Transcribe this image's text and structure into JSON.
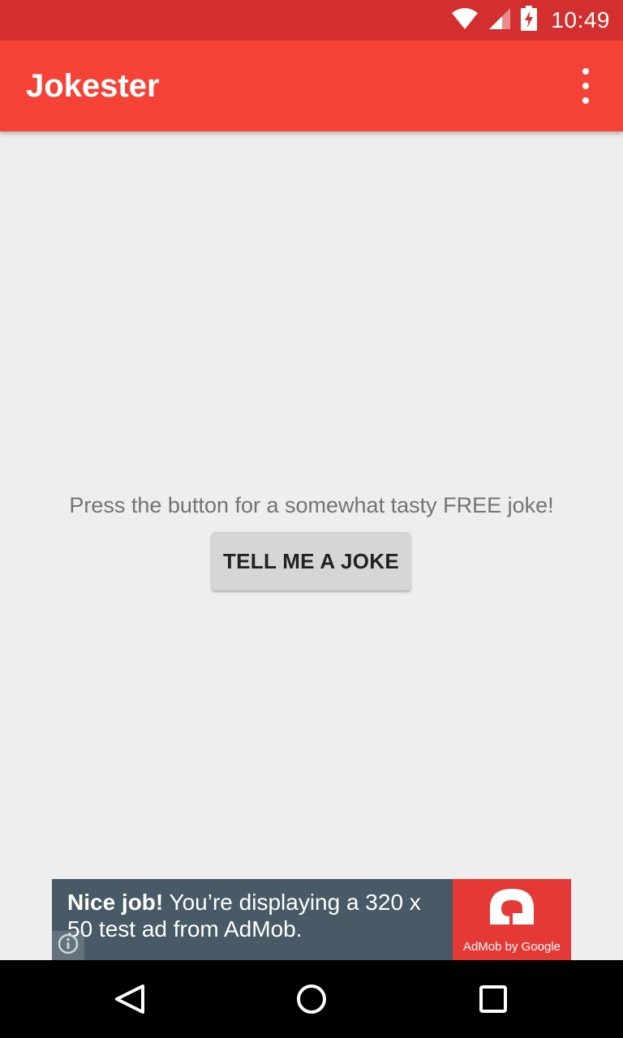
{
  "status_bar": {
    "time": "10:49",
    "icons": [
      "wifi-icon",
      "cellular-signal-icon",
      "battery-charging-icon"
    ]
  },
  "app_bar": {
    "title": "Jokester",
    "overflow_icon": "more-vert-icon"
  },
  "main": {
    "prompt": "Press the button for a somewhat tasty FREE joke!",
    "button_label": "TELL ME A JOKE"
  },
  "ad": {
    "headline": "Nice job!",
    "body": " You’re displaying a 320 x 50 test ad from AdMob.",
    "logo_caption": "AdMob by Google",
    "info_icon": "info-icon"
  },
  "nav": {
    "icons": [
      "back-icon",
      "home-icon",
      "recents-icon"
    ]
  },
  "colors": {
    "status_bar": "#d32f2f",
    "app_bar": "#f44336",
    "background": "#eeeeee",
    "ad_background": "#485a66",
    "ad_logo": "#e53935"
  }
}
